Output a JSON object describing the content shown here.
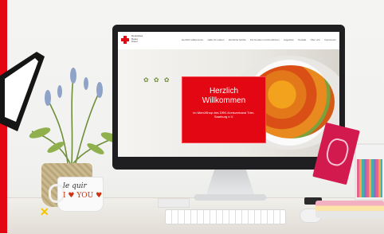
{
  "mug": {
    "line1": "le quir",
    "line2": "I ♥ YOU ♥"
  },
  "website": {
    "logo_text": [
      "Deutsches",
      "Rotes",
      "Kreuz"
    ],
    "nav": [
      "Herzlich willkommen",
      "Hallo ihr Lieben",
      "Herzliche Grüße",
      "Für Kunden und Kundinnen",
      "Angebote",
      "Kontakt",
      "Über uns",
      "Impressum"
    ],
    "welcome_title_line1": "Herzlich",
    "welcome_title_line2": "Willkommen",
    "welcome_sub": "im MenüShop des DRK-Kreisverband Trier-Saarburg e.V."
  },
  "colors": {
    "brand_red": "#e30613",
    "monitor": "#1f1f21"
  },
  "icons": [
    "red-cross-icon"
  ]
}
